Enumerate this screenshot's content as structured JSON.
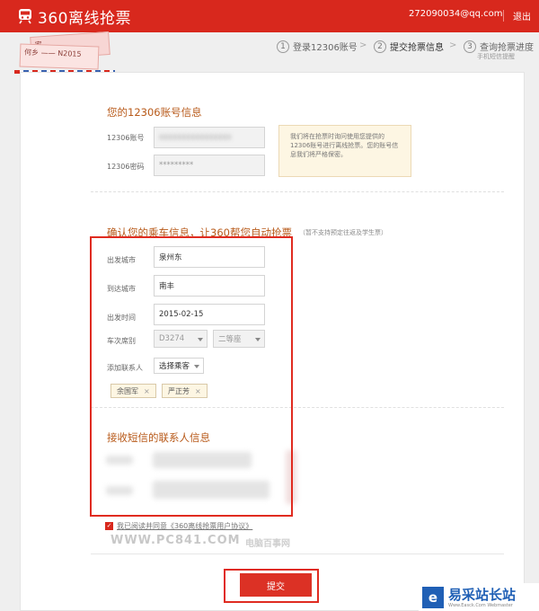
{
  "app": {
    "title": "360离线抢票",
    "user_email": "272090034@qq.com",
    "logout": "退出"
  },
  "tickets": {
    "t1_text": "家",
    "t2_text": "何乡 ——  N2015"
  },
  "steps": [
    {
      "num": "1",
      "label": "登录12306账号"
    },
    {
      "num": "2",
      "label": "提交抢票信息"
    },
    {
      "num": "3",
      "label": "查询抢票进度"
    }
  ],
  "steps_separator": ">",
  "steps_sub": "手机短信提醒",
  "account": {
    "title": "您的12306账号信息",
    "username_label": "12306账号",
    "username_value": "xxxxxxxxxxxxxxxx",
    "password_label": "12306密码",
    "password_value": "*********",
    "hint": "我们将在抢票时询问使用您提供的12306账号进行离线抢票。您的账号信息我们将严格保密。"
  },
  "passenger": {
    "title": "确认您的乘车信息，让360帮您自动抢票",
    "note": "（暂不支持预定往返及学生票）",
    "from_label": "出发城市",
    "from_value": "泉州东",
    "to_label": "到达城市",
    "to_value": "南丰",
    "date_label": "出发时间",
    "date_value": "2015-02-15",
    "train_label": "车次席别",
    "train_value": "D3274",
    "seat_value": "二等座",
    "contact_label": "添加联系人",
    "contact_select": "选择乘客",
    "chips": [
      {
        "name": "余国军",
        "x": "×"
      },
      {
        "name": "严正芳",
        "x": "×"
      }
    ]
  },
  "sms": {
    "title": "接收短信的联系人信息"
  },
  "agreement": "我已阅读并同意《360离线抢票用户协议》",
  "watermark": {
    "en": "WWW.PC841.COM",
    "cn": "电脑百事网"
  },
  "submit_label": "提交",
  "badge": {
    "icon": "e",
    "cn": "易采站长站",
    "en": "Www.Easck.Com Webmaster"
  },
  "colors": {
    "brand_red": "#d8281d",
    "section_title": "#b85a1a",
    "highlight_box": "#e02b20",
    "badge_blue": "#1f5fb5"
  }
}
